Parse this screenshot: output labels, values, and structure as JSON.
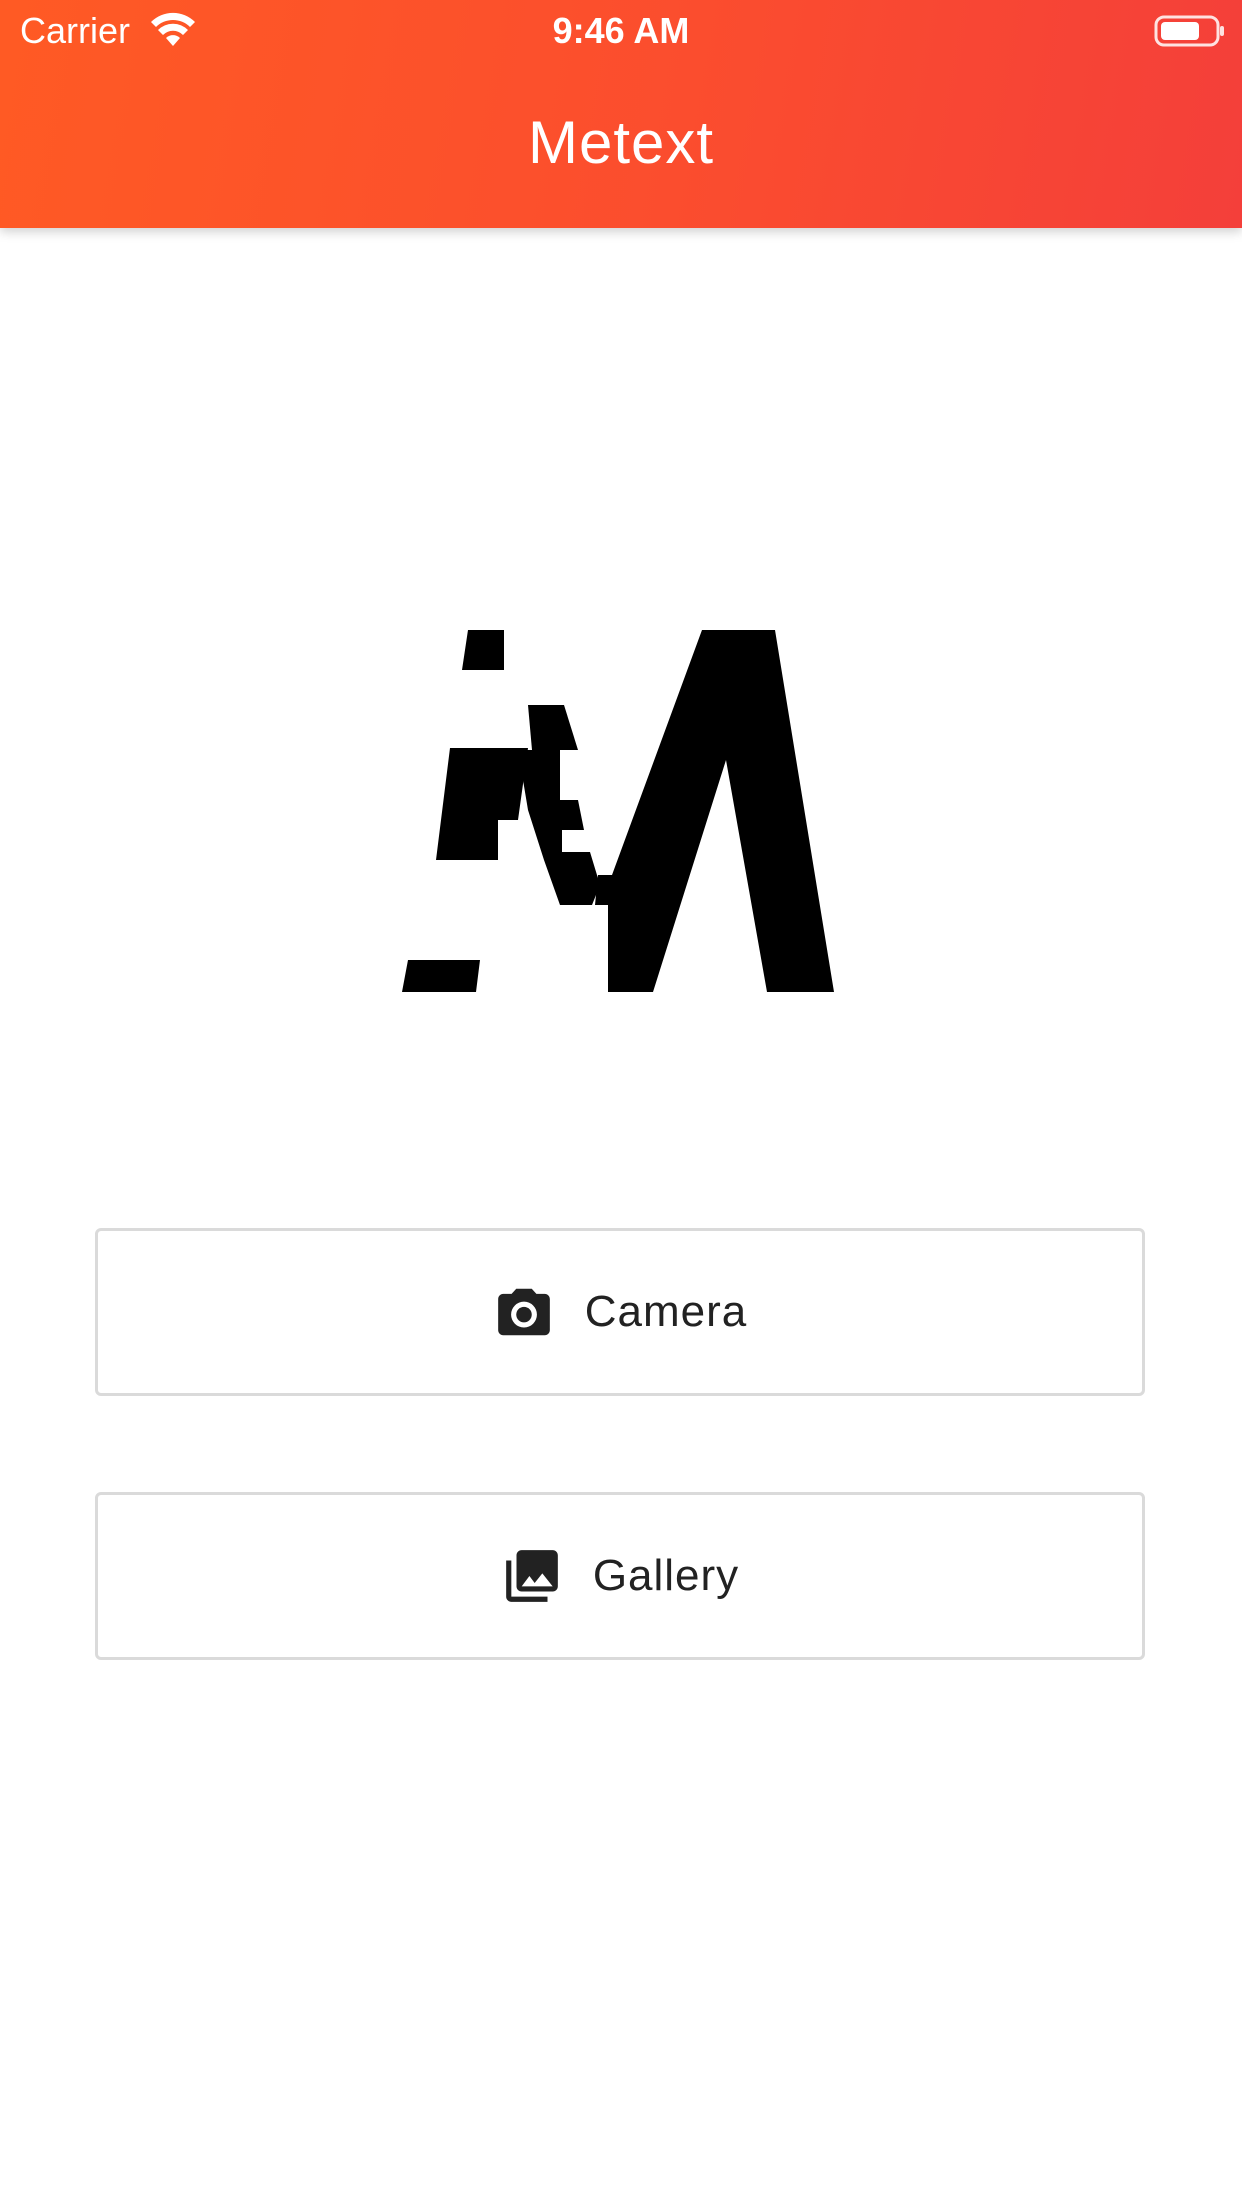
{
  "status_bar": {
    "carrier": "Carrier",
    "time": "9:46 AM",
    "wifi_icon": "wifi-icon",
    "battery_icon": "battery-icon"
  },
  "app_bar": {
    "title": "Metext",
    "gradient_start": "#ff5a24",
    "gradient_end": "#f43f3a"
  },
  "logo": {
    "icon": "metext-logo",
    "color": "#000000"
  },
  "buttons": {
    "camera": {
      "label": "Camera",
      "icon": "camera-icon"
    },
    "gallery": {
      "label": "Gallery",
      "icon": "photo-library-icon"
    }
  }
}
